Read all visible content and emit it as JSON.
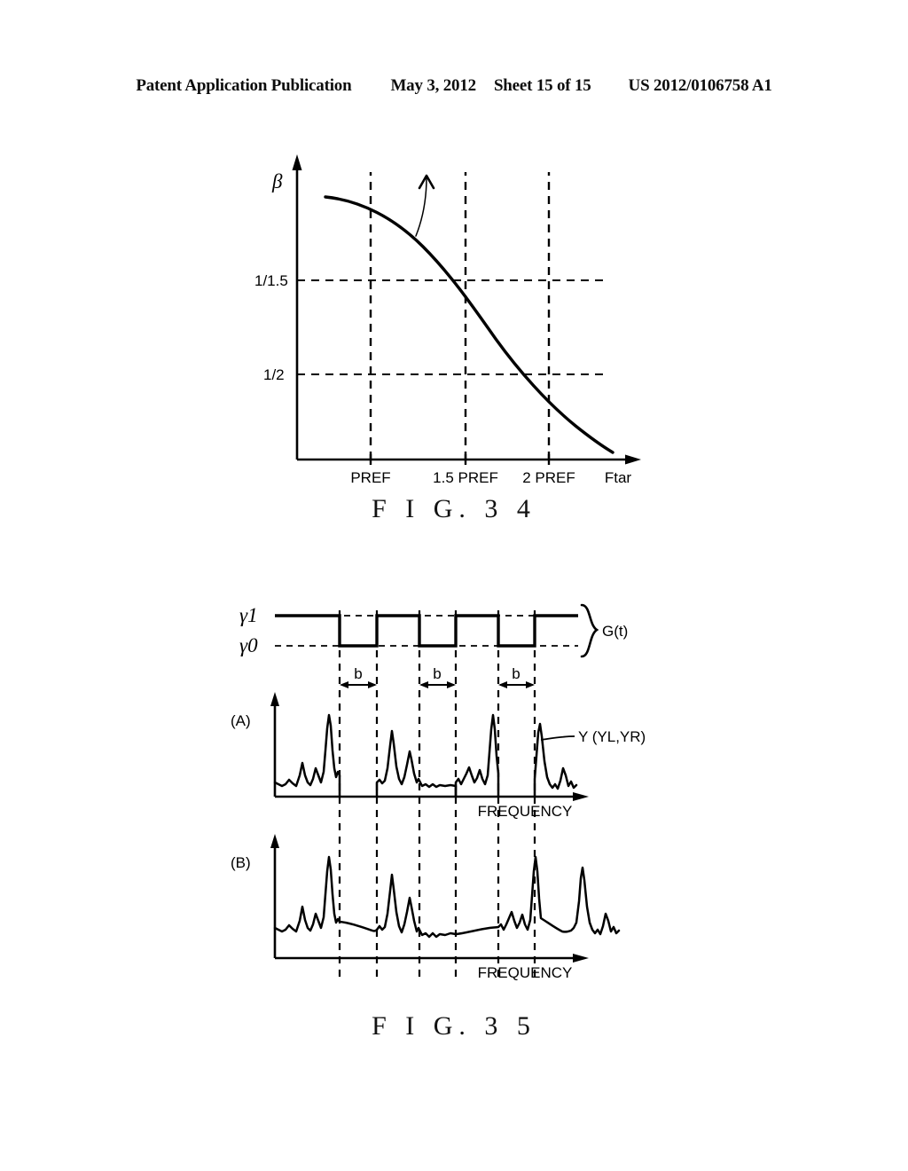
{
  "header": {
    "publication": "Patent Application Publication",
    "date": "May 3, 2012",
    "sheet": "Sheet 15 of 15",
    "docnum": "US 2012/0106758 A1"
  },
  "figures": [
    {
      "id": "fig-34",
      "caption": "F I G.  3 4",
      "chart_data": {
        "type": "line",
        "title": "FIG. 34",
        "xlabel": "Ftar",
        "ylabel": "β",
        "x_tick_labels": [
          "PREF",
          "1.5 PREF",
          "2 PREF"
        ],
        "y_tick_labels": [
          "1/1.5",
          "1/2"
        ],
        "grid": "dashed",
        "xlim": [
          0,
          1
        ],
        "ylim": [
          0,
          1
        ],
        "annotations": [
          {
            "name": "curve-pointer-caret",
            "symbol": "∧"
          }
        ],
        "series": [
          {
            "name": "beta-vs-Ftar",
            "comment": "monotonically decreasing curve; crosses 1/1.5 at 1.5 PREF and 1/2 at 2 PREF",
            "points": [
              [
                0.115,
                0.885
              ],
              [
                0.2,
                0.872
              ],
              [
                0.29,
                0.845
              ],
              [
                0.38,
                0.8
              ],
              [
                0.47,
                0.735
              ],
              [
                0.56,
                0.655
              ],
              [
                0.62,
                0.595
              ],
              [
                0.68,
                0.52
              ],
              [
                0.76,
                0.425
              ],
              [
                0.83,
                0.33
              ],
              [
                0.9,
                0.24
              ],
              [
                0.96,
                0.16
              ],
              [
                1.0,
                0.108
              ]
            ]
          }
        ]
      }
    },
    {
      "id": "fig-35",
      "caption": "F I G.  3 5",
      "gate": {
        "high_label": "γ1",
        "low_label": "γ0",
        "brace_label": "G(t)",
        "interval_label": "b",
        "intervals": [
          {
            "label": "b",
            "start": 0.245,
            "end": 0.352
          },
          {
            "label": "b",
            "start": 0.475,
            "end": 0.583
          },
          {
            "label": "b",
            "start": 0.706,
            "end": 0.813
          }
        ]
      },
      "panels": [
        {
          "label": "(A)",
          "xlabel": "FREQUENCY",
          "annotation": "Y (YL,YR)",
          "gated": true,
          "chart_data": {
            "type": "line",
            "title": "(A) gated spectrum",
            "xlabel": "FREQUENCY",
            "ylabel": "",
            "legend": [
              "Y (YL,YR)"
            ],
            "comment": "spectrum with signal forced to zero inside each b interval"
          }
        },
        {
          "label": "(B)",
          "xlabel": "FREQUENCY",
          "annotation": "",
          "gated": false,
          "chart_data": {
            "type": "line",
            "title": "(B) interpolated spectrum",
            "xlabel": "FREQUENCY",
            "ylabel": "",
            "legend": [],
            "comment": "same spectrum with b intervals smoothly interpolated instead of zeroed"
          }
        }
      ]
    }
  ]
}
